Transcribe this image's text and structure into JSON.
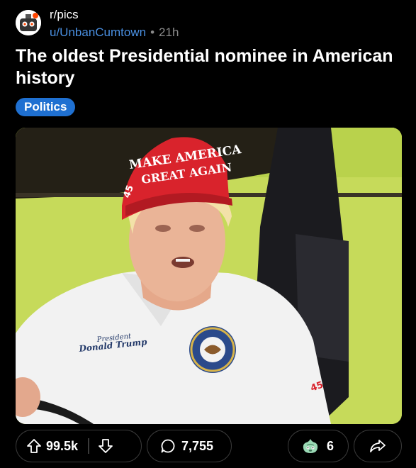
{
  "post": {
    "subreddit": "r/pics",
    "author": "u/UnbanCumtown",
    "separator": "•",
    "age": "21h",
    "title": "The oldest Presidential nominee in American history",
    "flair": "Politics",
    "flair_color": "#1f70d1"
  },
  "image": {
    "hat_text_line1": "MAKE AMERICA",
    "hat_text_line2": "GREAT AGAIN",
    "hat_side_number": "45",
    "shirt_embroidery_line1": "President",
    "shirt_embroidery_line2": "Donald Trump",
    "sleeve_number": "45"
  },
  "actions": {
    "upvotes": "99.5k",
    "comments": "7,755",
    "awards": "6"
  },
  "colors": {
    "background": "#000000",
    "username": "#4a90e2",
    "muted": "#8a8a8a",
    "pill_border": "#3a3a3a"
  },
  "icons": {
    "subreddit_avatar": "subreddit-avatar",
    "upvote": "arrow-up-icon",
    "downvote": "arrow-down-icon",
    "comment": "speech-bubble-icon",
    "award": "award-icon",
    "share": "share-arrow-icon"
  }
}
